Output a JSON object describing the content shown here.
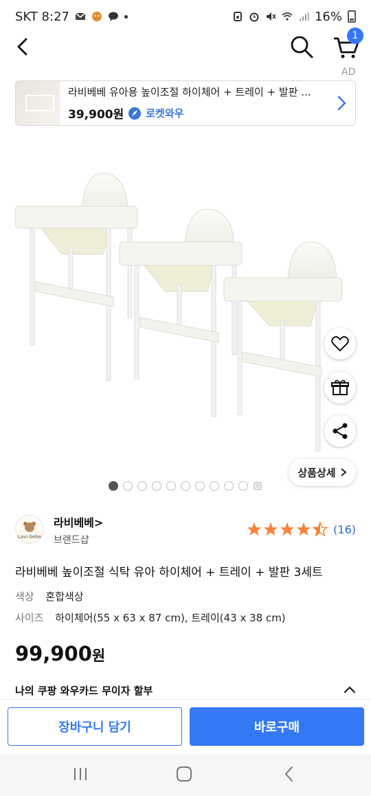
{
  "status_bar": {
    "carrier_time": "SKT 8:27",
    "battery": "16%"
  },
  "nav": {
    "cart_count": "1",
    "ad_label": "AD"
  },
  "ad": {
    "title": "라비베베 유아용 높이조절 하이체어 + 트레이 + 발판 ...",
    "price": "39,900원",
    "badge": "로켓와우"
  },
  "gallery": {
    "total_pages": 10,
    "current_page": 1,
    "detail_button": "상품상세"
  },
  "brand": {
    "name": "라비베베",
    "name_suffix": ">",
    "subtitle": "브랜드샵",
    "logo_text": "Lavi bebe",
    "rating": 4.5,
    "review_count": "(16)"
  },
  "product": {
    "title": "라비베베 높이조절 식탁 유아 하이체어 + 트레이 + 발판 3세트",
    "options": [
      {
        "label": "색상",
        "value": "혼합색상"
      },
      {
        "label": "사이즈",
        "value": "하이체어(55 x 63 x 87 cm), 트레이(43 x 38 cm)"
      }
    ],
    "price_number": "99,900",
    "price_unit": "원",
    "card_offer": "나의 쿠팡 와우카드 무이자 할부"
  },
  "actions": {
    "add_to_cart": "장바구니 담기",
    "buy_now": "바로구매"
  },
  "colors": {
    "accent": "#3478f6",
    "star": "#f7823a",
    "link": "#2a66c8"
  }
}
